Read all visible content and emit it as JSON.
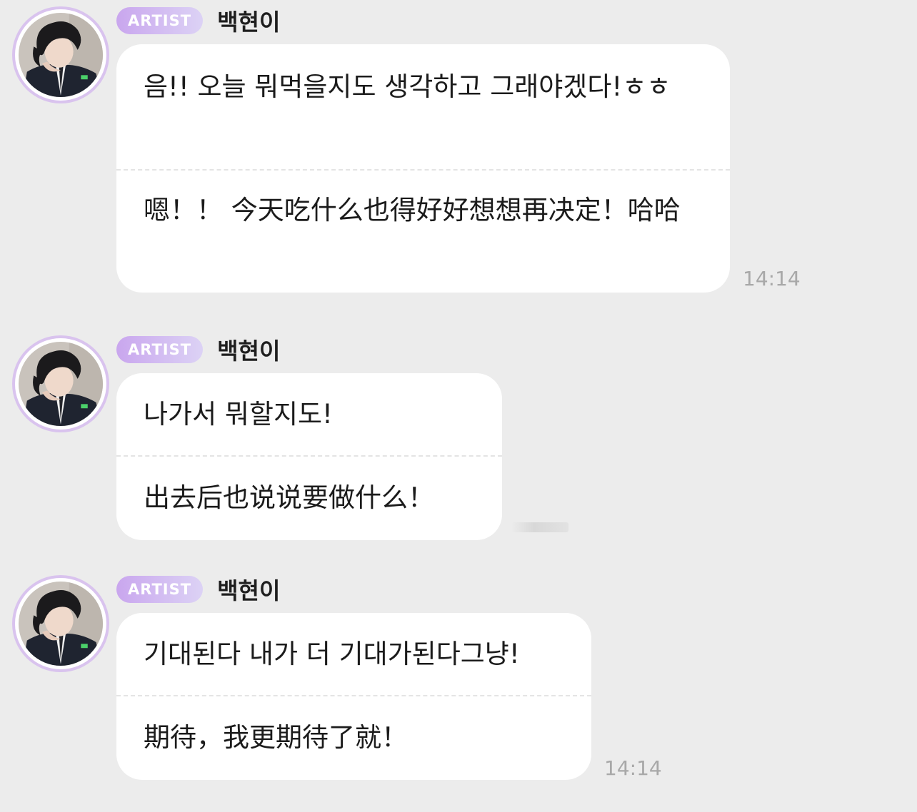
{
  "badge_label": "ARTIST",
  "colors": {
    "background": "#ececec",
    "bubble": "#ffffff",
    "badge_gradient_start": "#c9a6ee",
    "badge_gradient_end": "#dcd2f5",
    "avatar_ring": "#d9c3ee",
    "timestamp": "#a8a8a8"
  },
  "messages": [
    {
      "author": "백현이",
      "badge": "ARTIST",
      "original": "음!! 오늘 뭐먹을지도 생각하고 그래야겠다!ㅎㅎ",
      "translation": "嗯！！ 今天吃什么也得好好想想再决定！哈哈",
      "time": "14:14",
      "avatar_icon": "profile-photo"
    },
    {
      "author": "백현이",
      "badge": "ARTIST",
      "original": "나가서 뭐할지도!",
      "translation": "出去后也说说要做什么！",
      "time": "",
      "avatar_icon": "profile-photo"
    },
    {
      "author": "백현이",
      "badge": "ARTIST",
      "original": "기대된다 내가 더 기대가된다그냥!",
      "translation": "期待，我更期待了就！",
      "time": "14:14",
      "avatar_icon": "profile-photo"
    }
  ]
}
